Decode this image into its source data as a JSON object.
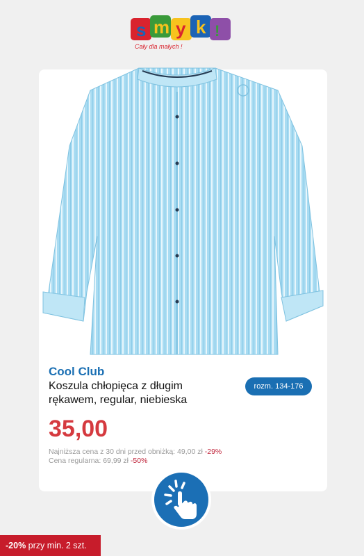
{
  "logo": {
    "brand_text": "smyk",
    "slogan": "Cały dla małych !"
  },
  "product": {
    "brand": "Cool Club",
    "title_line1": "Koszula chłopięca z długim",
    "title_line2": "rękawem, regular, niebieska",
    "size_range": "rozm. 134-176",
    "price": "35,00",
    "lowest_price_label": "Najniższa cena z 30 dni przed obniżką: 49,00 zł",
    "lowest_price_pct": "-29%",
    "regular_price_label": "Cena regularna: 69,99 zł",
    "regular_price_pct": "-50%"
  },
  "promo": {
    "discount": "-20%",
    "condition": "przy min. 2 szt."
  },
  "colors": {
    "brand_blue": "#1a6fb3",
    "price_red": "#d53a3f",
    "promo_red": "#c71c2b",
    "shirt_blue": "#a9dcf2"
  },
  "icons": {
    "cta": "tap-hand-icon",
    "shirt": "product-image"
  }
}
